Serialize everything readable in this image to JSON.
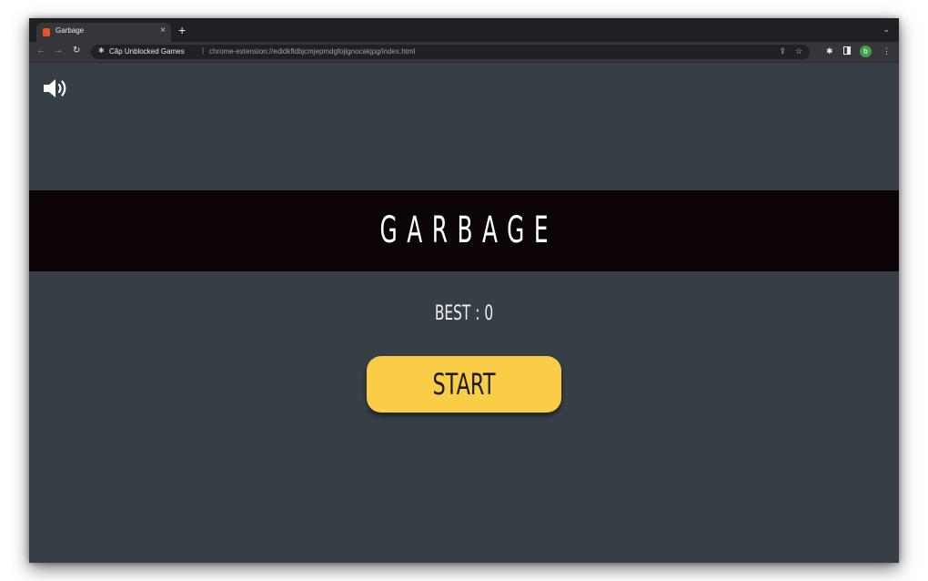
{
  "browser": {
    "tab": {
      "title": "Garbage",
      "close_glyph": "×",
      "favicon_color": "#e8552b"
    },
    "new_tab_glyph": "+",
    "tab_menu_glyph": "⌄",
    "nav": {
      "back_glyph": "←",
      "forward_glyph": "→",
      "reload_glyph": "↻"
    },
    "address": {
      "site_name": "Căp Unblocked Games",
      "separator": "|",
      "url": "chrome-extension://edidkfldbjcmjepmdgfojlgnocakjpg/index.html"
    },
    "toolbar_icons": {
      "share_glyph": "⇪",
      "bookmark_glyph": "☆",
      "extensions_glyph": "✱",
      "profile_letter": "b",
      "menu_glyph": "⋮"
    }
  },
  "game": {
    "title": "GARBAGE",
    "best_label": "BEST : 0",
    "start_label": "START",
    "sound_icon": "speaker-volume-icon",
    "colors": {
      "background": "#353f45",
      "banner": "#0b0306",
      "start_button": "#f9cd45"
    }
  }
}
